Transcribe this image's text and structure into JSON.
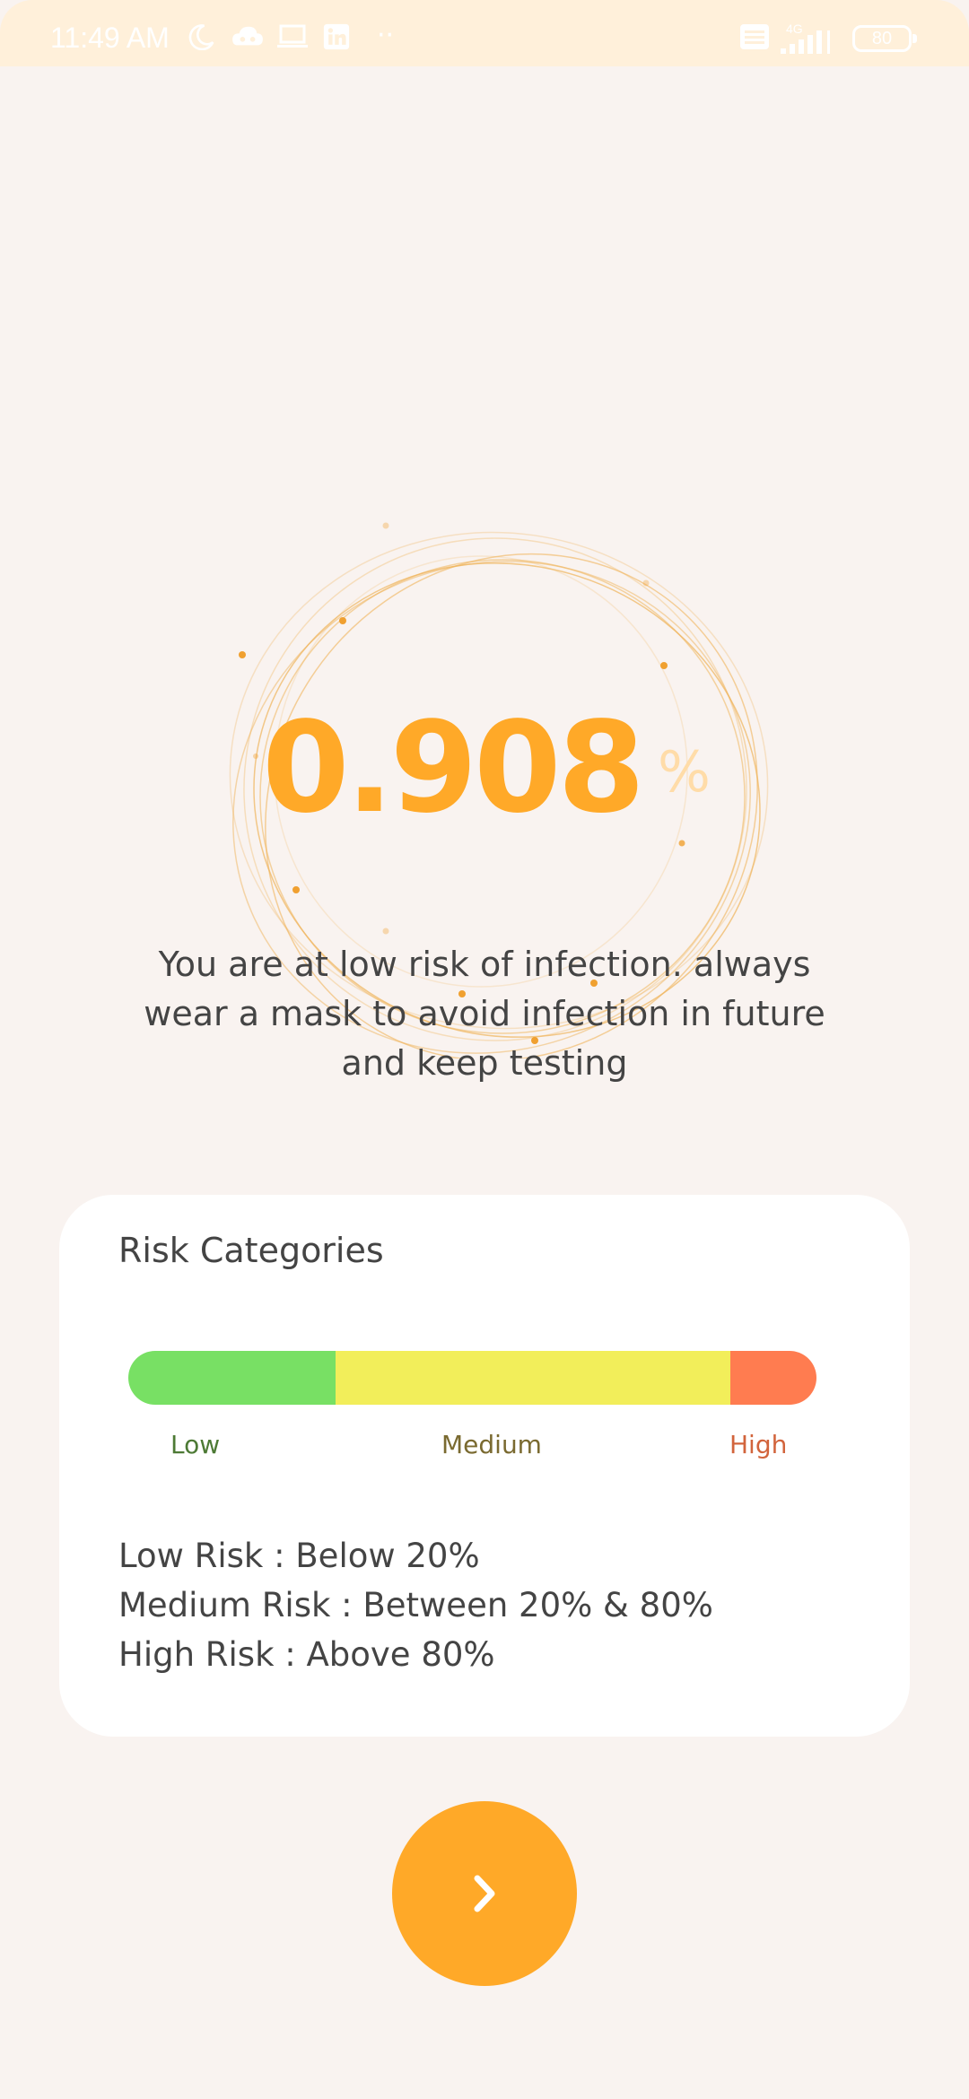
{
  "status_bar": {
    "time": "11:49 AM",
    "dots": "··",
    "battery": "80",
    "network": "4G",
    "icons": [
      "moon-icon",
      "cloud-game-icon",
      "laptop-icon",
      "linkedin-icon",
      "volte-icon",
      "signal-icon",
      "battery-icon"
    ]
  },
  "result": {
    "value": "0.908",
    "unit": "%",
    "message": "You are at low risk of infection. always wear a mask to avoid infection in future and keep testing"
  },
  "categories_card": {
    "title": "Risk Categories",
    "bar_labels": {
      "low": "Low",
      "medium": "Medium",
      "high": "High"
    },
    "rules": [
      "Low Risk : Below 20%",
      "Medium Risk : Between 20% & 80%",
      "High Risk : Above 80%"
    ],
    "colors": {
      "low": "#78e064",
      "medium": "#f2ee5a",
      "high": "#ff7c50"
    }
  },
  "next_button": {
    "icon": "chevron-right-icon",
    "color": "#ffa928"
  }
}
